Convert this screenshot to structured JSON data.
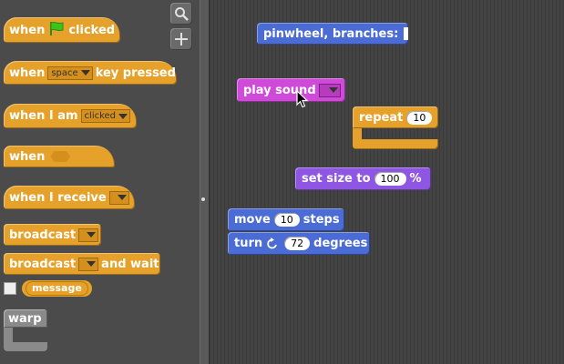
{
  "palette": {
    "blocks": {
      "when_flag_before": "when",
      "when_flag_after": "clicked",
      "when_key_before": "when",
      "when_key_value": "space",
      "when_key_after": "key pressed",
      "when_i_am_label": "when I am",
      "when_i_am_value": "clicked",
      "when_condition_label": "when",
      "when_receive_label": "when I receive",
      "broadcast_label": "broadcast",
      "broadcast_wait_before": "broadcast",
      "broadcast_wait_after": "and wait",
      "message_label": "message",
      "warp_label": "warp"
    }
  },
  "scripts": {
    "pinwheel_label": "pinwheel, branches:",
    "play_sound_label": "play sound",
    "repeat_label": "repeat",
    "repeat_value": "10",
    "set_size_label": "set size to",
    "set_size_value": "100",
    "set_size_unit": "%",
    "move_label": "move",
    "move_value": "10",
    "move_unit": "steps",
    "turn_label": "turn",
    "turn_value": "72",
    "turn_unit": "degrees"
  },
  "icons": {
    "zoom_search": "magnifier-icon",
    "zoom_add": "plus-icon",
    "green_flag": "green-flag-icon",
    "turn_arrow": "rotate-ccw-icon",
    "cursor": "mouse-pointer-icon"
  },
  "colors": {
    "control": "#e6a12b",
    "motion": "#4a6cd4",
    "looks": "#8f56e3",
    "sound": "#cf4ad9",
    "palette_bg": "#4b4b4b",
    "script_bg": "#434343"
  }
}
